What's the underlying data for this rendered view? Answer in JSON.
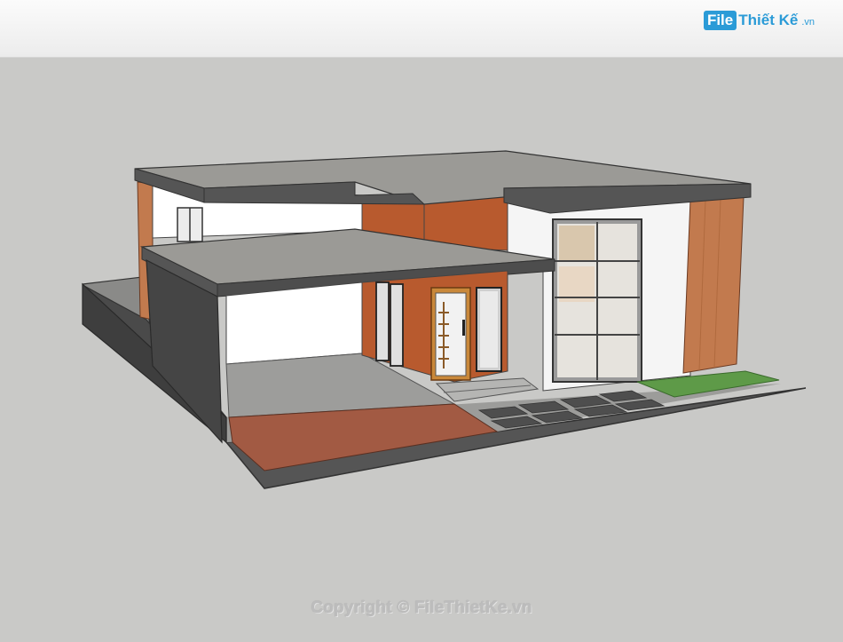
{
  "watermark": {
    "logo_box": "File",
    "logo_name": "Thiết Kế",
    "logo_tld": ".vn",
    "copyright": "Copyright © FileThietKe.vn"
  },
  "colors": {
    "background": "#c9c9c7",
    "roof_edge": "#555555",
    "roof_top": "#9b9a96",
    "accent_wall": "#b85a2e",
    "wood": "#c27a4e",
    "lawn": "#5e9a48",
    "paving": "#a25a43"
  }
}
